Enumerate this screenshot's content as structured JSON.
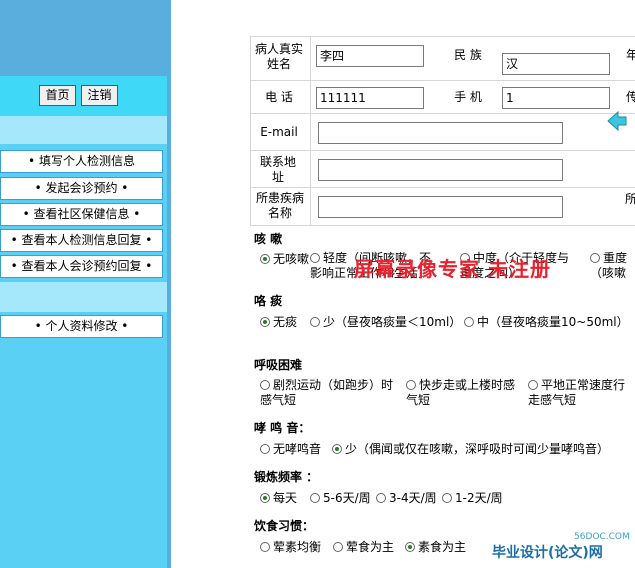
{
  "nav": {
    "home_label": "首页",
    "logout_label": "注销"
  },
  "menu": [
    {
      "label": "• 填写个人检测信息"
    },
    {
      "label": "• 发起会诊预约 •"
    },
    {
      "label": "• 查看社区保健信息 •"
    },
    {
      "label": "• 查看本人检测信息回复 •"
    },
    {
      "label": "• 查看本人会诊预约回复 •"
    }
  ],
  "menu2": [
    {
      "label": "• 个人资料修改 •"
    }
  ],
  "form": {
    "name_label": "病人真实姓名",
    "name_value": "李四",
    "ethnic_label": "民 族",
    "ethnic_value": "汉",
    "phone_label": "电 话",
    "phone_value": "111111",
    "mobile_label": "手 机",
    "mobile_value": "1",
    "email_label": "E-mail",
    "email_value": "",
    "address_label": "联系地址",
    "address_value": "",
    "disease_label": "所患疾病名称",
    "disease_value": "",
    "right_col_1": "年",
    "right_col_2": "传",
    "right_col_3": "所"
  },
  "sections": {
    "cough": {
      "title": "咳 嗽",
      "options": [
        "无咳嗽",
        "轻度（间断咳嗽，不影响正常工作和生活）",
        "中度（介于轻度与重度之间）",
        "重度（咳嗽影响"
      ],
      "selected": 0
    },
    "phlegm": {
      "title": "咯 痰",
      "options": [
        "无痰",
        "少（昼夜咯痰量＜10ml）",
        "中（昼夜咯痰量10~50ml）"
      ],
      "selected": 0
    },
    "dyspnea": {
      "title": "呼吸困难",
      "options": [
        "剧烈运动（如跑步）时感气短",
        "快步走或上楼时感气短",
        "平地正常速度行走感气短"
      ],
      "selected": -1
    },
    "wheeze": {
      "title": "哮 鸣 音：",
      "options": [
        "无哮鸣音",
        "少（偶闻或仅在咳嗽，深呼吸时可闻少量哮鸣音）"
      ],
      "selected": 1
    },
    "exercise": {
      "title": "锻炼频率 ：",
      "options": [
        "每天",
        "5-6天/周",
        "3-4天/周",
        "1-2天/周"
      ],
      "selected": 0
    },
    "diet": {
      "title": "饮食习惯：",
      "options": [
        "荤素均衡",
        "荤食为主",
        "素食为主"
      ],
      "selected": 2
    }
  },
  "watermark": {
    "text": "屏幕录像专家 未注册",
    "site": "毕业设计(论文)网",
    "site_url_text": "56DOC.COM"
  }
}
